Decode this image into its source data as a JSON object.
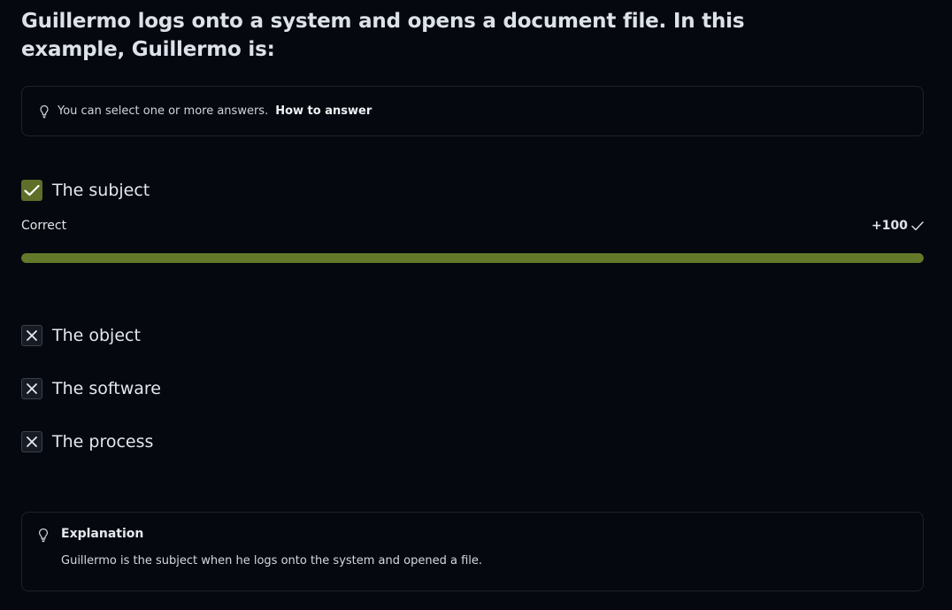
{
  "question": "Guillermo logs onto a system and opens a document file. In this example, Guillermo is:",
  "hint": {
    "text": "You can select one or more answers.",
    "link": "How to answer"
  },
  "options": [
    {
      "label": "The subject",
      "state": "checked"
    },
    {
      "label": "The object",
      "state": "crossed"
    },
    {
      "label": "The software",
      "state": "crossed"
    },
    {
      "label": "The process",
      "state": "crossed"
    }
  ],
  "result": {
    "status": "Correct",
    "points": "+100",
    "progress_percent": 100
  },
  "explanation": {
    "title": "Explanation",
    "text": "Guillermo is the subject when he logs onto the system and opened a file."
  },
  "colors": {
    "background": "#05080e",
    "correct_accent": "#647829",
    "checkbox_checked": "#5f6e28"
  }
}
